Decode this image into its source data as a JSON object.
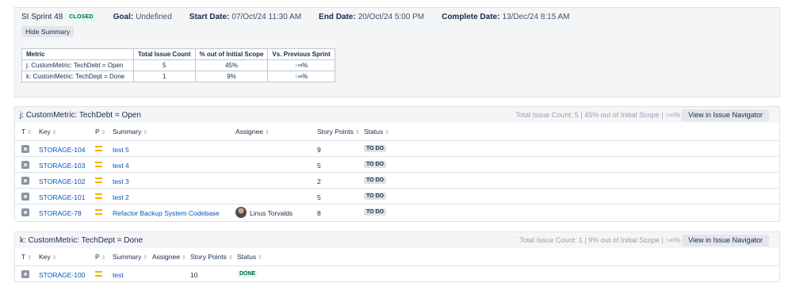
{
  "sprint": {
    "name": "SI Sprint 48",
    "status": "CLOSED",
    "goal_label": "Goal:",
    "goal_value": "Undefined",
    "start_label": "Start Date:",
    "start_value": "07/Oct/24 11:30 AM",
    "end_label": "End Date:",
    "end_value": "20/Oct/24 5:00 PM",
    "complete_label": "Complete Date:",
    "complete_value": "13/Dec/24 8:15 AM",
    "hide_summary_label": "Hide Summary"
  },
  "metrics": {
    "headers": [
      "Metric",
      "Total Issue Count",
      "% out of Initial Scope",
      "Vs. Previous Sprint"
    ],
    "rows": [
      {
        "metric": "j: CustomMetric: TechDebt = Open",
        "count": "5",
        "scope": "45%",
        "vs": "∞%"
      },
      {
        "metric": "k: CustomMetric: TechDept = Done",
        "count": "1",
        "scope": "9%",
        "vs": "∞%"
      }
    ]
  },
  "groups": {
    "j": {
      "title": "j: CustomMetric: TechDebt = Open",
      "stats_prefix": "Total Issue Count: 5 | 45% out of Initial Scope | ",
      "stats_suffix": "∞%",
      "nav_label": "View in Issue Navigator",
      "headers": {
        "t": "T",
        "key": "Key",
        "p": "P",
        "summary": "Summary",
        "assignee": "Assignee",
        "points": "Story Points",
        "status": "Status"
      },
      "rows": [
        {
          "key": "STORAGE-104",
          "summary": "test 5",
          "assignee": "",
          "points": "9",
          "status": "TO DO"
        },
        {
          "key": "STORAGE-103",
          "summary": "test 4",
          "assignee": "",
          "points": "5",
          "status": "TO DO"
        },
        {
          "key": "STORAGE-102",
          "summary": "test 3",
          "assignee": "",
          "points": "2",
          "status": "TO DO"
        },
        {
          "key": "STORAGE-101",
          "summary": "test 2",
          "assignee": "",
          "points": "5",
          "status": "TO DO"
        },
        {
          "key": "STORAGE-78",
          "summary": "Refactor Backup System Codebase",
          "assignee": "Linus Torvalds",
          "points": "8",
          "status": "TO DO"
        }
      ]
    },
    "k": {
      "title": "k: CustomMetric: TechDept = Done",
      "stats_prefix": "Total Issue Count: 1 | 9% out of Initial Scope | ",
      "stats_suffix": "∞%",
      "nav_label": "View in Issue Navigator",
      "headers": {
        "t": "T",
        "key": "Key",
        "p": "P",
        "summary": "Summary",
        "assignee": "Assignee",
        "points": "Story Points",
        "status": "Status"
      },
      "rows": [
        {
          "key": "STORAGE-100",
          "summary": "test",
          "points": "10",
          "status": "DONE"
        }
      ]
    }
  },
  "colors": {
    "link": "#0052cc",
    "closed_badge": "#006644",
    "priority_medium": "#ffab00",
    "trend_up": "#00875a"
  },
  "icons": {
    "issue_type": "task-icon",
    "priority": "priority-medium-icon",
    "sort": "sort-icon",
    "trend": "arrow-up-icon"
  }
}
